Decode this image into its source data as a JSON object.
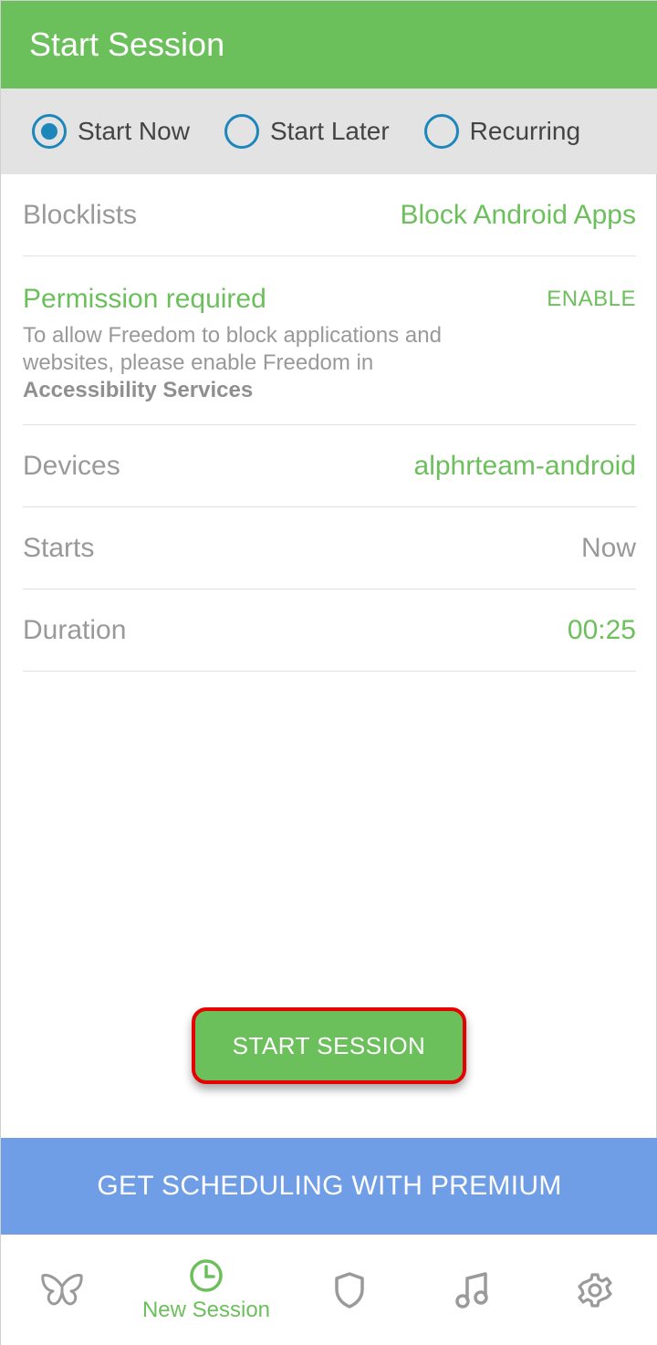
{
  "header": {
    "title": "Start Session"
  },
  "mode_options": [
    {
      "label": "Start Now",
      "selected": true
    },
    {
      "label": "Start Later",
      "selected": false
    },
    {
      "label": "Recurring",
      "selected": false
    }
  ],
  "blocklists": {
    "label": "Blocklists",
    "value": "Block Android Apps"
  },
  "permission": {
    "title": "Permission required",
    "action": "ENABLE",
    "description": "To allow Freedom to block applications and websites, please enable Freedom in",
    "description_bold": "Accessibility Services"
  },
  "devices": {
    "label": "Devices",
    "value": "alphrteam-android"
  },
  "starts": {
    "label": "Starts",
    "value": "Now"
  },
  "duration": {
    "label": "Duration",
    "value": "00:25"
  },
  "start_button": {
    "label": "START SESSION"
  },
  "premium_banner": {
    "label": "GET SCHEDULING WITH PREMIUM"
  },
  "bottom_nav": {
    "items": [
      {
        "icon": "butterfly-icon",
        "label": ""
      },
      {
        "icon": "clock-icon",
        "label": "New Session",
        "active": true
      },
      {
        "icon": "shield-icon",
        "label": ""
      },
      {
        "icon": "music-note-icon",
        "label": ""
      },
      {
        "icon": "gear-icon",
        "label": ""
      }
    ]
  },
  "colors": {
    "accent": "#6cc05c",
    "radio": "#1d86bb",
    "premium": "#6f9ee6",
    "highlight_border": "#e60000"
  }
}
